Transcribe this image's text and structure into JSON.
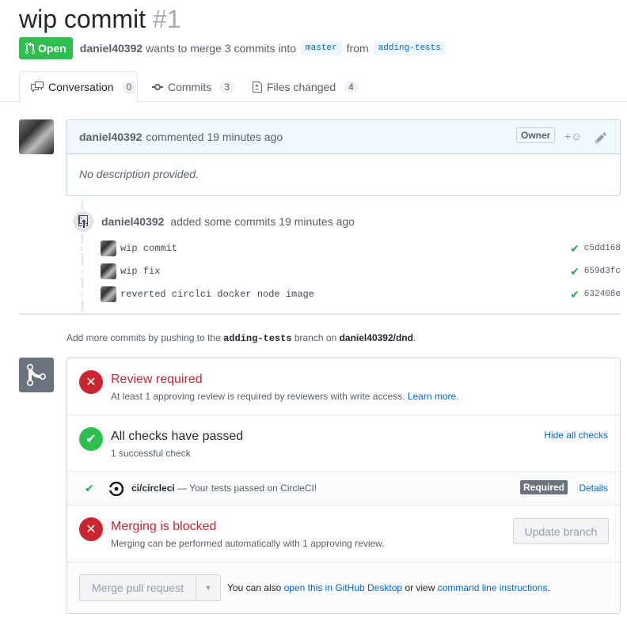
{
  "title": "wip commit",
  "number": "#1",
  "state": "Open",
  "meta": {
    "author": "daniel40392",
    "text": "wants to merge 3 commits into",
    "base_branch": "master",
    "from": "from",
    "head_branch": "adding-tests"
  },
  "tabs": [
    {
      "label": "Conversation",
      "count": "0"
    },
    {
      "label": "Commits",
      "count": "3"
    },
    {
      "label": "Files changed",
      "count": "4"
    }
  ],
  "comment": {
    "author": "daniel40392",
    "action": "commented 19 minutes ago",
    "role": "Owner",
    "body": "No description provided."
  },
  "commits_event": {
    "author": "daniel40392",
    "action": "added some commits 19 minutes ago"
  },
  "commits": [
    {
      "message": "wip commit",
      "sha": "c5dd168"
    },
    {
      "message": "wip fix",
      "sha": "659d3fc"
    },
    {
      "message": "reverted circlci docker node image",
      "sha": "632408e"
    }
  ],
  "push_hint": {
    "pre": "Add more commits by pushing to the",
    "branch": "adding-tests",
    "mid": "branch on",
    "repo": "daniel40392/dnd",
    "post": "."
  },
  "merge": {
    "review": {
      "title": "Review required",
      "sub": "At least 1 approving review is required by reviewers with write access.",
      "link": "Learn more."
    },
    "checks": {
      "title": "All checks have passed",
      "sub": "1 successful check",
      "toggle": "Hide all checks"
    },
    "check_item": {
      "name": "ci/circleci",
      "desc": "— Your tests passed on CircleCI!",
      "required": "Required",
      "details": "Details"
    },
    "blocked": {
      "title": "Merging is blocked",
      "sub": "Merging can be performed automatically with 1 approving review.",
      "button": "Update branch"
    },
    "footer": {
      "merge_button": "Merge pull request",
      "pre": "You can also",
      "desktop_link": "open this in GitHub Desktop",
      "mid": "or view",
      "cli_link": "command line instructions",
      "post": "."
    }
  },
  "colors": {
    "open_green": "#2cbe4e",
    "error_red": "#cb2431",
    "link_blue": "#0366d6"
  }
}
